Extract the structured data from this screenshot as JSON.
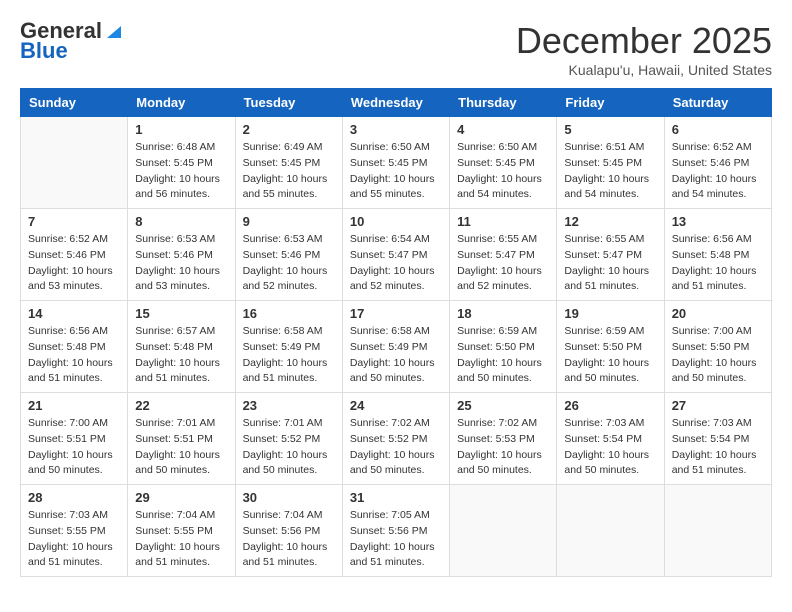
{
  "header": {
    "logo_general": "General",
    "logo_blue": "Blue",
    "month_title": "December 2025",
    "subtitle": "Kualapu'u, Hawaii, United States"
  },
  "days_of_week": [
    "Sunday",
    "Monday",
    "Tuesday",
    "Wednesday",
    "Thursday",
    "Friday",
    "Saturday"
  ],
  "weeks": [
    [
      {
        "day": "",
        "info": ""
      },
      {
        "day": "1",
        "info": "Sunrise: 6:48 AM\nSunset: 5:45 PM\nDaylight: 10 hours\nand 56 minutes."
      },
      {
        "day": "2",
        "info": "Sunrise: 6:49 AM\nSunset: 5:45 PM\nDaylight: 10 hours\nand 55 minutes."
      },
      {
        "day": "3",
        "info": "Sunrise: 6:50 AM\nSunset: 5:45 PM\nDaylight: 10 hours\nand 55 minutes."
      },
      {
        "day": "4",
        "info": "Sunrise: 6:50 AM\nSunset: 5:45 PM\nDaylight: 10 hours\nand 54 minutes."
      },
      {
        "day": "5",
        "info": "Sunrise: 6:51 AM\nSunset: 5:45 PM\nDaylight: 10 hours\nand 54 minutes."
      },
      {
        "day": "6",
        "info": "Sunrise: 6:52 AM\nSunset: 5:46 PM\nDaylight: 10 hours\nand 54 minutes."
      }
    ],
    [
      {
        "day": "7",
        "info": "Sunrise: 6:52 AM\nSunset: 5:46 PM\nDaylight: 10 hours\nand 53 minutes."
      },
      {
        "day": "8",
        "info": "Sunrise: 6:53 AM\nSunset: 5:46 PM\nDaylight: 10 hours\nand 53 minutes."
      },
      {
        "day": "9",
        "info": "Sunrise: 6:53 AM\nSunset: 5:46 PM\nDaylight: 10 hours\nand 52 minutes."
      },
      {
        "day": "10",
        "info": "Sunrise: 6:54 AM\nSunset: 5:47 PM\nDaylight: 10 hours\nand 52 minutes."
      },
      {
        "day": "11",
        "info": "Sunrise: 6:55 AM\nSunset: 5:47 PM\nDaylight: 10 hours\nand 52 minutes."
      },
      {
        "day": "12",
        "info": "Sunrise: 6:55 AM\nSunset: 5:47 PM\nDaylight: 10 hours\nand 51 minutes."
      },
      {
        "day": "13",
        "info": "Sunrise: 6:56 AM\nSunset: 5:48 PM\nDaylight: 10 hours\nand 51 minutes."
      }
    ],
    [
      {
        "day": "14",
        "info": "Sunrise: 6:56 AM\nSunset: 5:48 PM\nDaylight: 10 hours\nand 51 minutes."
      },
      {
        "day": "15",
        "info": "Sunrise: 6:57 AM\nSunset: 5:48 PM\nDaylight: 10 hours\nand 51 minutes."
      },
      {
        "day": "16",
        "info": "Sunrise: 6:58 AM\nSunset: 5:49 PM\nDaylight: 10 hours\nand 51 minutes."
      },
      {
        "day": "17",
        "info": "Sunrise: 6:58 AM\nSunset: 5:49 PM\nDaylight: 10 hours\nand 50 minutes."
      },
      {
        "day": "18",
        "info": "Sunrise: 6:59 AM\nSunset: 5:50 PM\nDaylight: 10 hours\nand 50 minutes."
      },
      {
        "day": "19",
        "info": "Sunrise: 6:59 AM\nSunset: 5:50 PM\nDaylight: 10 hours\nand 50 minutes."
      },
      {
        "day": "20",
        "info": "Sunrise: 7:00 AM\nSunset: 5:50 PM\nDaylight: 10 hours\nand 50 minutes."
      }
    ],
    [
      {
        "day": "21",
        "info": "Sunrise: 7:00 AM\nSunset: 5:51 PM\nDaylight: 10 hours\nand 50 minutes."
      },
      {
        "day": "22",
        "info": "Sunrise: 7:01 AM\nSunset: 5:51 PM\nDaylight: 10 hours\nand 50 minutes."
      },
      {
        "day": "23",
        "info": "Sunrise: 7:01 AM\nSunset: 5:52 PM\nDaylight: 10 hours\nand 50 minutes."
      },
      {
        "day": "24",
        "info": "Sunrise: 7:02 AM\nSunset: 5:52 PM\nDaylight: 10 hours\nand 50 minutes."
      },
      {
        "day": "25",
        "info": "Sunrise: 7:02 AM\nSunset: 5:53 PM\nDaylight: 10 hours\nand 50 minutes."
      },
      {
        "day": "26",
        "info": "Sunrise: 7:03 AM\nSunset: 5:54 PM\nDaylight: 10 hours\nand 50 minutes."
      },
      {
        "day": "27",
        "info": "Sunrise: 7:03 AM\nSunset: 5:54 PM\nDaylight: 10 hours\nand 51 minutes."
      }
    ],
    [
      {
        "day": "28",
        "info": "Sunrise: 7:03 AM\nSunset: 5:55 PM\nDaylight: 10 hours\nand 51 minutes."
      },
      {
        "day": "29",
        "info": "Sunrise: 7:04 AM\nSunset: 5:55 PM\nDaylight: 10 hours\nand 51 minutes."
      },
      {
        "day": "30",
        "info": "Sunrise: 7:04 AM\nSunset: 5:56 PM\nDaylight: 10 hours\nand 51 minutes."
      },
      {
        "day": "31",
        "info": "Sunrise: 7:05 AM\nSunset: 5:56 PM\nDaylight: 10 hours\nand 51 minutes."
      },
      {
        "day": "",
        "info": ""
      },
      {
        "day": "",
        "info": ""
      },
      {
        "day": "",
        "info": ""
      }
    ]
  ]
}
